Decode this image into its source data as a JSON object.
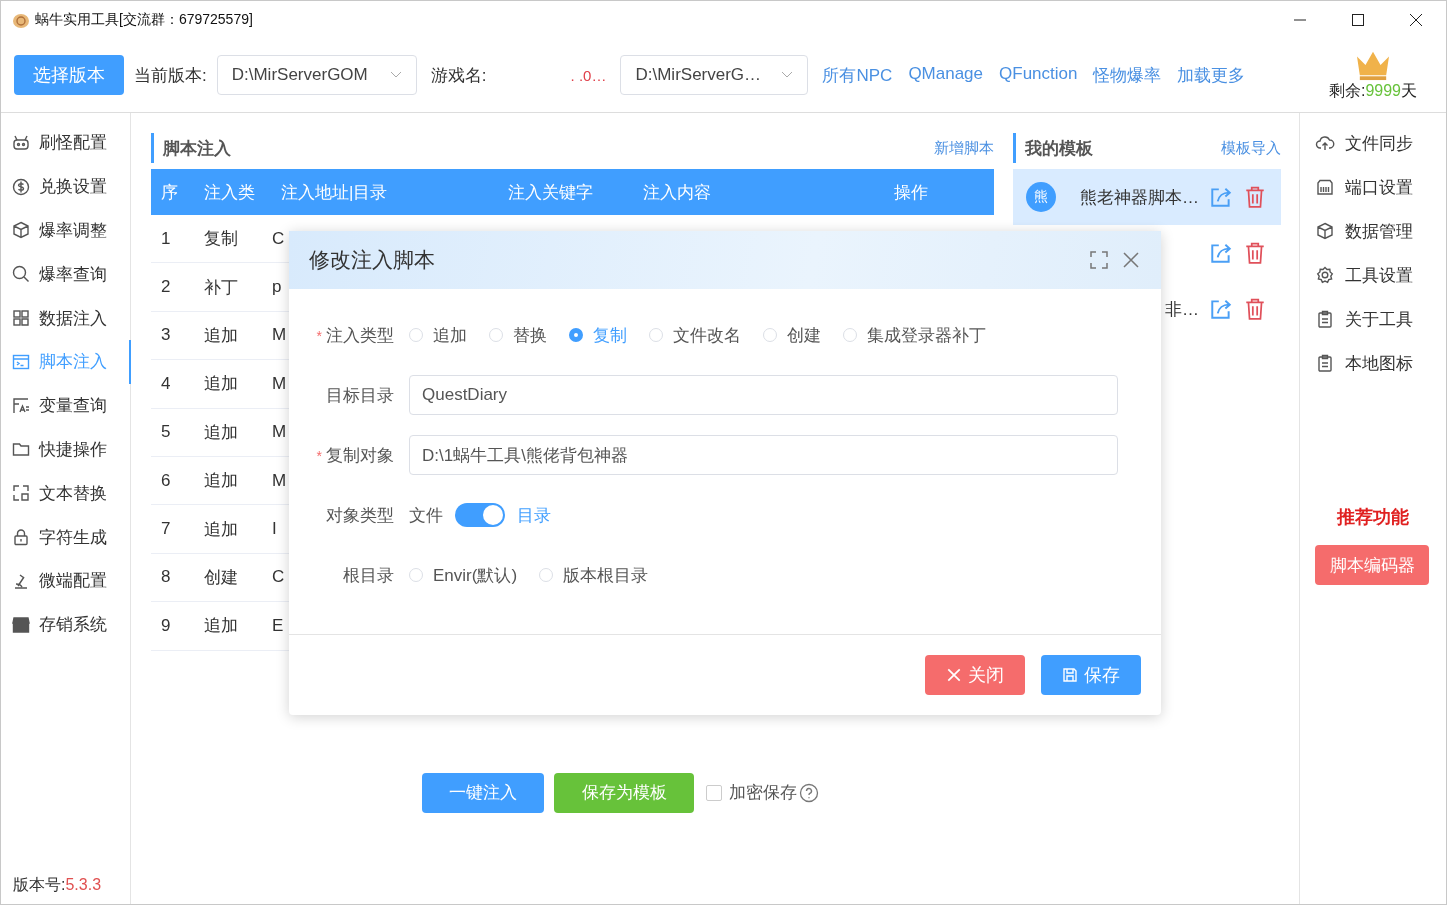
{
  "window": {
    "title": "蜗牛实用工具[交流群：679725579]"
  },
  "toolbar": {
    "select_version": "选择版本",
    "current_version_label": "当前版本:",
    "current_version": "D:\\MirServerGOM",
    "game_name_label": "游戏名:",
    "game_name": ". .0…",
    "game_path": "D:\\MirServerG…",
    "links": [
      "所有NPC",
      "QManage",
      "QFunction",
      "怪物爆率",
      "加载更多"
    ],
    "remaining": {
      "prefix": "剩余:",
      "days": "9999",
      "suffix": "天"
    }
  },
  "sidebar": {
    "items": [
      {
        "label": "刷怪配置",
        "selected": false
      },
      {
        "label": "兑换设置",
        "selected": false
      },
      {
        "label": "爆率调整",
        "selected": false
      },
      {
        "label": "爆率查询",
        "selected": false
      },
      {
        "label": "数据注入",
        "selected": false
      },
      {
        "label": "脚本注入",
        "selected": true
      },
      {
        "label": "变量查询",
        "selected": false
      },
      {
        "label": "快捷操作",
        "selected": false
      },
      {
        "label": "文本替换",
        "selected": false
      },
      {
        "label": "字符生成",
        "selected": false
      },
      {
        "label": "微端配置",
        "selected": false
      },
      {
        "label": "存销系统",
        "selected": false
      }
    ],
    "version_label": "版本号:",
    "version": "5.3.3"
  },
  "script_panel": {
    "title": "脚本注入",
    "add_link": "新增脚本",
    "table": {
      "columns": [
        "序",
        "注入类",
        "注入地址|目录",
        "注入关键字",
        "注入内容",
        "操作"
      ],
      "rows": [
        [
          "1",
          "复制",
          "C"
        ],
        [
          "2",
          "补丁",
          "p"
        ],
        [
          "3",
          "追加",
          "M"
        ],
        [
          "4",
          "追加",
          "M"
        ],
        [
          "5",
          "追加",
          "M"
        ],
        [
          "6",
          "追加",
          "M"
        ],
        [
          "7",
          "追加",
          "I"
        ],
        [
          "8",
          "创建",
          "C"
        ],
        [
          "9",
          "追加",
          "E"
        ]
      ]
    },
    "inject_button": "一键注入",
    "save_template_button": "保存为模板",
    "encrypt": {
      "label": "加密保存",
      "checked": false
    }
  },
  "template_panel": {
    "title": "我的模板",
    "import_link": "模板导入",
    "items": [
      {
        "avatar": "熊",
        "name": "熊老神器脚本…",
        "selected": true
      },
      {
        "selected": false
      },
      {
        "name": "非…",
        "selected": false
      }
    ]
  },
  "right_sidebar": {
    "items": [
      {
        "label": "文件同步"
      },
      {
        "label": "端口设置"
      },
      {
        "label": "数据管理"
      },
      {
        "label": "工具设置"
      },
      {
        "label": "关于工具"
      },
      {
        "label": "本地图标"
      }
    ],
    "recommend_title": "推荐功能",
    "recommend_button": "脚本编码器"
  },
  "dialog": {
    "title": "修改注入脚本",
    "inject_type": {
      "label": "注入类型",
      "required_mark": "*",
      "options": [
        {
          "label": "追加",
          "selected": false
        },
        {
          "label": "替换",
          "selected": false
        },
        {
          "label": "复制",
          "selected": true
        },
        {
          "label": "文件改名",
          "selected": false
        },
        {
          "label": "创建",
          "selected": false
        },
        {
          "label": "集成登录器补丁",
          "selected": false
        }
      ]
    },
    "target_dir": {
      "label": "目标目录",
      "value": "QuestDiary"
    },
    "copy_source": {
      "label": "复制对象",
      "required_mark": "*",
      "value": "D:\\1蜗牛工具\\熊佬背包神器"
    },
    "object_type": {
      "label": "对象类型",
      "off_label": "文件",
      "on_label": "目录",
      "on": true
    },
    "root_dir": {
      "label": "根目录",
      "options": [
        {
          "label": "Envir(默认)",
          "selected": false
        },
        {
          "label": "版本根目录",
          "selected": false
        }
      ]
    },
    "close_button": "关闭",
    "save_button": "保存"
  }
}
